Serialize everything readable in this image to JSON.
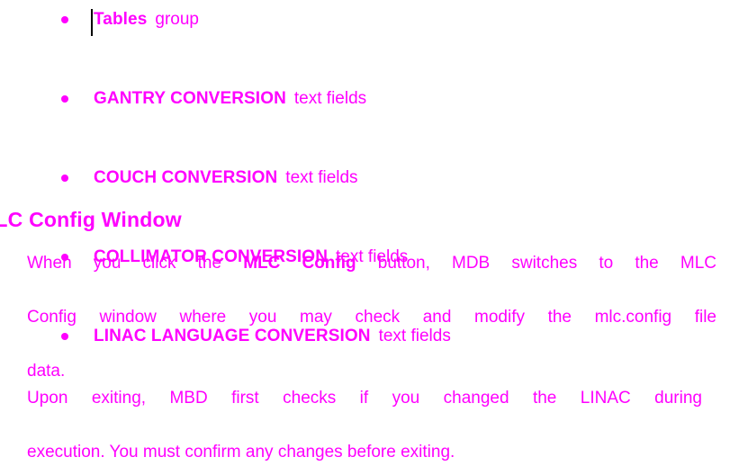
{
  "page": {
    "background_color": "#ffffff",
    "text_color": "#ff00ff",
    "caret_color": "#000000"
  },
  "bullets": [
    {
      "bold": "Tables",
      "regular": "group"
    },
    {
      "bold": "GANTRY CONVERSION",
      "regular": "text  fields"
    },
    {
      "bold": "COUCH CONVERSION",
      "regular": "text  fields"
    },
    {
      "bold": "COLLIMATOR CONVERSION",
      "regular": "text  fields"
    },
    {
      "bold": "LINAC LANGUAGE CONVERSION",
      "regular": "text  fields"
    }
  ],
  "heading": {
    "text": "oose MLC Config Window",
    "full_text_inferred": "Choose MLC Config Window"
  },
  "paragraph_1": {
    "line_1_a": "When you click the",
    "line_1_bold": "MLC Config",
    "line_1_b": "button, MDB switches to the MLC",
    "line_2": "Config window where you may check and modify the mlc.config file",
    "line_3": "data."
  },
  "paragraph_2": {
    "line_1": "Upon exiting, MBD first checks if you changed the LINAC during",
    "line_2": "execution. You must confirm any changes before exiting."
  }
}
